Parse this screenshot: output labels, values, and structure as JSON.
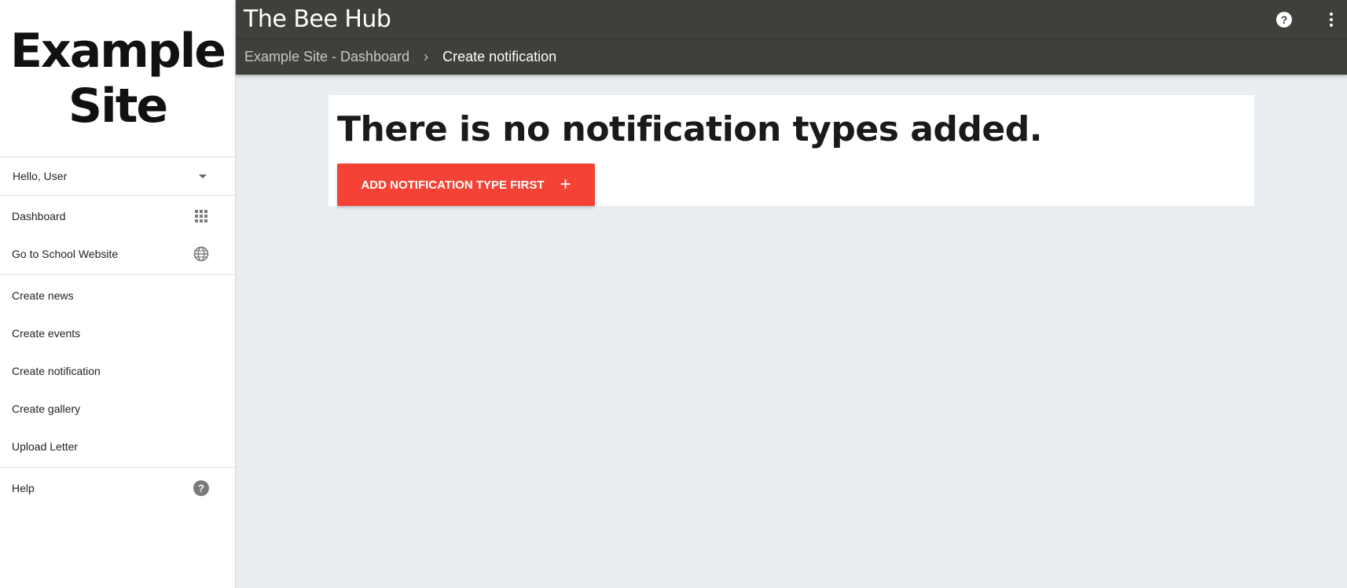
{
  "sidebar": {
    "logo_text": "Example\nSite",
    "user_greeting": "Hello, User",
    "nav_primary": [
      {
        "label": "Dashboard",
        "icon": "apps-grid-icon"
      },
      {
        "label": "Go to School Website",
        "icon": "globe-icon"
      }
    ],
    "nav_create": [
      {
        "label": "Create news"
      },
      {
        "label": "Create events"
      },
      {
        "label": "Create notification"
      },
      {
        "label": "Create gallery"
      },
      {
        "label": "Upload Letter"
      }
    ],
    "nav_help": {
      "label": "Help",
      "icon": "help-circle-icon"
    }
  },
  "header": {
    "title": "The Bee Hub",
    "help_icon_glyph": "?"
  },
  "breadcrumb": {
    "parent": "Example Site - Dashboard",
    "separator": "›",
    "current": "Create notification"
  },
  "main": {
    "message": "There is no notification types added.",
    "add_button_label": "ADD NOTIFICATION TYPE FIRST",
    "add_button_icon": "+"
  },
  "colors": {
    "topbar": "#3f3f3b",
    "accent_button": "#f44336",
    "background": "#e9edf0"
  }
}
